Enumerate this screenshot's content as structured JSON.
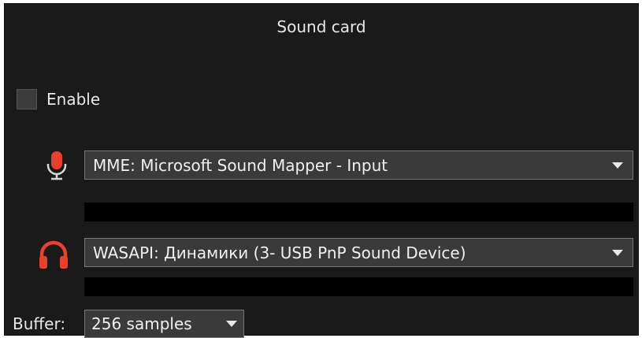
{
  "window": {
    "title": "Sound card"
  },
  "enable": {
    "label": "Enable",
    "checked": false
  },
  "input_device": {
    "icon": "microphone-icon",
    "icon_color": "#e8402c",
    "value": "MME: Microsoft Sound Mapper - Input"
  },
  "output_device": {
    "icon": "headphones-icon",
    "icon_color": "#e8402c",
    "value": "WASAPI: Динамики (3- USB PnP Sound Device)"
  },
  "buffer": {
    "label": "Buffer:",
    "value": "256 samples"
  },
  "colors": {
    "panel_bg": "#1a1a1a",
    "accent": "#e8402c",
    "text": "#e8e8e8"
  }
}
